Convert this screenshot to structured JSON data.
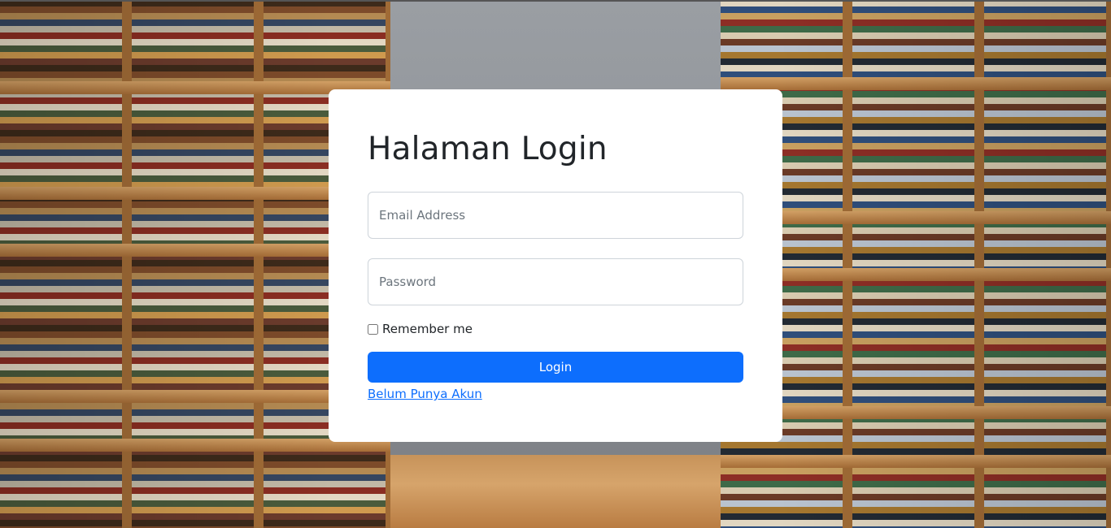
{
  "login": {
    "title": "Halaman Login",
    "email_placeholder": "Email Address",
    "email_value": "",
    "password_placeholder": "Password",
    "password_value": "",
    "remember_label": "Remember me",
    "remember_checked": false,
    "submit_label": "Login",
    "register_link_label": "Belum Punya Akun"
  },
  "theme": {
    "primary": "#0d6efd",
    "card_background": "#ffffff",
    "text_color": "#212529"
  },
  "background": {
    "description_icon": "library-bookshelves-photo"
  }
}
